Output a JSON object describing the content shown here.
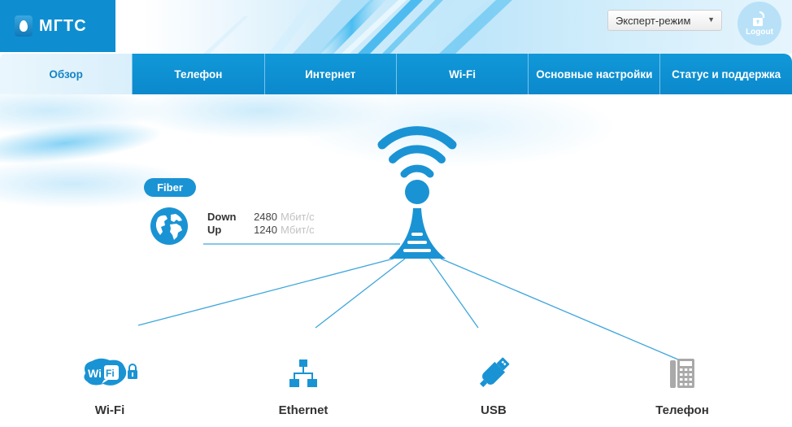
{
  "header": {
    "logo_text": "МГТС",
    "mode_select": {
      "value": "Эксперт-режим"
    },
    "logout_label": "Logout"
  },
  "tabs": [
    {
      "label": "Обзор",
      "active": true
    },
    {
      "label": "Телефон",
      "active": false
    },
    {
      "label": "Интернет",
      "active": false
    },
    {
      "label": "Wi-Fi",
      "active": false
    },
    {
      "label": "Основные настройки",
      "active": false
    },
    {
      "label": "Статус и поддержка",
      "active": false
    }
  ],
  "overview": {
    "connection_type": "Fiber",
    "down_label": "Down",
    "down_value": "2480",
    "up_label": "Up",
    "up_value": "1240",
    "unit": "Мбит/с",
    "devices": [
      {
        "label": "Wi-Fi",
        "icon": "wifi-lock-icon"
      },
      {
        "label": "Ethernet",
        "icon": "network-icon"
      },
      {
        "label": "USB",
        "icon": "usb-icon"
      },
      {
        "label": "Телефон",
        "icon": "desk-phone-icon"
      }
    ]
  },
  "colors": {
    "brand_blue": "#0e8ed0",
    "icon_blue": "#1a93d4",
    "phone_gray": "#a9a9a9"
  }
}
